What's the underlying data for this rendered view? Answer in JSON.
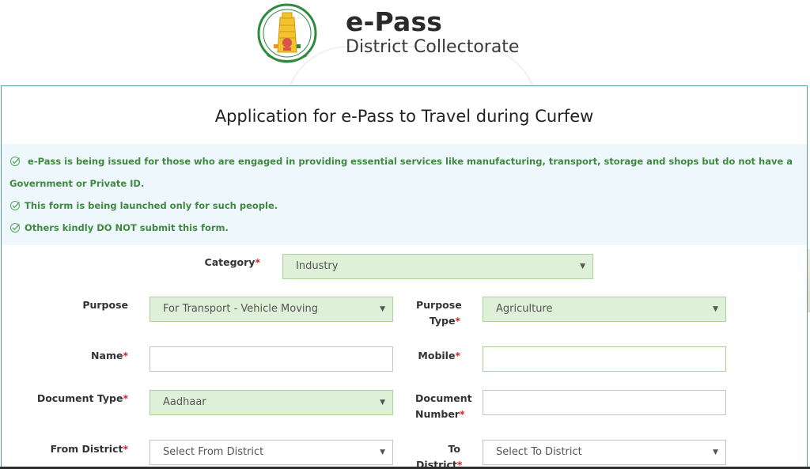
{
  "header": {
    "emblem_icon": "tamil-nadu-emblem-icon",
    "title": "e-Pass",
    "subtitle": "District Collectorate"
  },
  "form": {
    "title": "Application for e-Pass to Travel during Curfew",
    "notices": [
      "e-Pass is being issued for those who are engaged in providing essential services like manufacturing, transport, storage and shops but do not have a Government or Private ID.",
      "This form is being launched only for such people.",
      "Others kindly DO NOT submit this form."
    ],
    "required_marker": "*",
    "fields": {
      "category": {
        "label": "Category",
        "value": "Industry"
      },
      "purpose": {
        "label": "Purpose",
        "value": "For Transport - Vehicle Moving"
      },
      "purpose_type": {
        "label_line1": "Purpose",
        "label_line2": "Type",
        "value": "Agriculture"
      },
      "name": {
        "label": "Name",
        "value": ""
      },
      "mobile": {
        "label": "Mobile",
        "value": ""
      },
      "document_type": {
        "label": "Document Type",
        "value": "Aadhaar"
      },
      "document_number": {
        "label_line1": "Document",
        "label_line2": "Number",
        "value": ""
      },
      "from_district": {
        "label": "From District",
        "value": "Select From District"
      },
      "to_district": {
        "label_line1": "To",
        "label_line2": "District",
        "value": "Select To District"
      }
    },
    "colors": {
      "notice_text": "#3f8a3f",
      "notice_bg": "#eef7fb",
      "filled_select_bg": "#dff0d8",
      "required": "#c62828",
      "panel_border": "#5a9aa0"
    }
  }
}
